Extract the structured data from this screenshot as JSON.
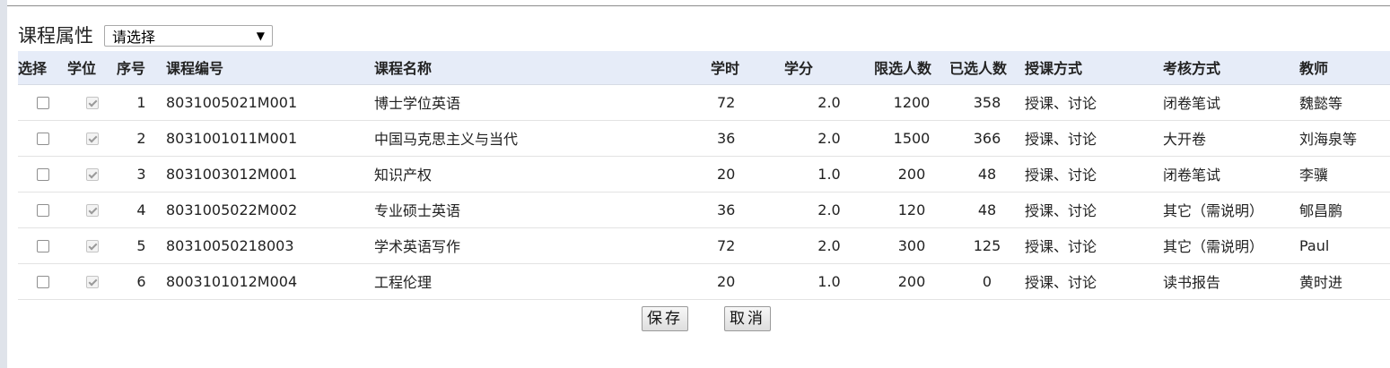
{
  "filter": {
    "label": "课程属性",
    "select_value": "请选择",
    "select_arrow": "▼"
  },
  "table": {
    "headers": {
      "select": "选择",
      "degree": "学位",
      "seq": "序号",
      "code": "课程编号",
      "name": "课程名称",
      "hours": "学时",
      "credits": "学分",
      "limit": "限选人数",
      "enrolled": "已选人数",
      "method": "授课方式",
      "exam": "考核方式",
      "teacher": "教师"
    },
    "rows": [
      {
        "selected": false,
        "degree": true,
        "seq": "1",
        "code": "8031005021M001",
        "name": "博士学位英语",
        "hours": "72",
        "credits": "2.0",
        "limit": "1200",
        "enrolled": "358",
        "method": "授课、讨论",
        "exam": "闭卷笔试",
        "teacher": "魏懿等"
      },
      {
        "selected": false,
        "degree": true,
        "seq": "2",
        "code": "8031001011M001",
        "name": "中国马克思主义与当代",
        "hours": "36",
        "credits": "2.0",
        "limit": "1500",
        "enrolled": "366",
        "method": "授课、讨论",
        "exam": "大开卷",
        "teacher": "刘海泉等"
      },
      {
        "selected": false,
        "degree": true,
        "seq": "3",
        "code": "8031003012M001",
        "name": "知识产权",
        "hours": "20",
        "credits": "1.0",
        "limit": "200",
        "enrolled": "48",
        "method": "授课、讨论",
        "exam": "闭卷笔试",
        "teacher": "李骥"
      },
      {
        "selected": false,
        "degree": true,
        "seq": "4",
        "code": "8031005022M002",
        "name": "专业硕士英语",
        "hours": "36",
        "credits": "2.0",
        "limit": "120",
        "enrolled": "48",
        "method": "授课、讨论",
        "exam": "其它（需说明）",
        "teacher": "郇昌鹏"
      },
      {
        "selected": false,
        "degree": true,
        "seq": "5",
        "code": "80310050218003",
        "name": "学术英语写作",
        "hours": "72",
        "credits": "2.0",
        "limit": "300",
        "enrolled": "125",
        "method": "授课、讨论",
        "exam": "其它（需说明）",
        "teacher": "Paul"
      },
      {
        "selected": false,
        "degree": true,
        "seq": "6",
        "code": "8003101012M004",
        "name": "工程伦理",
        "hours": "20",
        "credits": "1.0",
        "limit": "200",
        "enrolled": "0",
        "method": "授课、讨论",
        "exam": "读书报告",
        "teacher": "黄时进"
      }
    ]
  },
  "buttons": {
    "save": "保存",
    "cancel": "取消"
  }
}
